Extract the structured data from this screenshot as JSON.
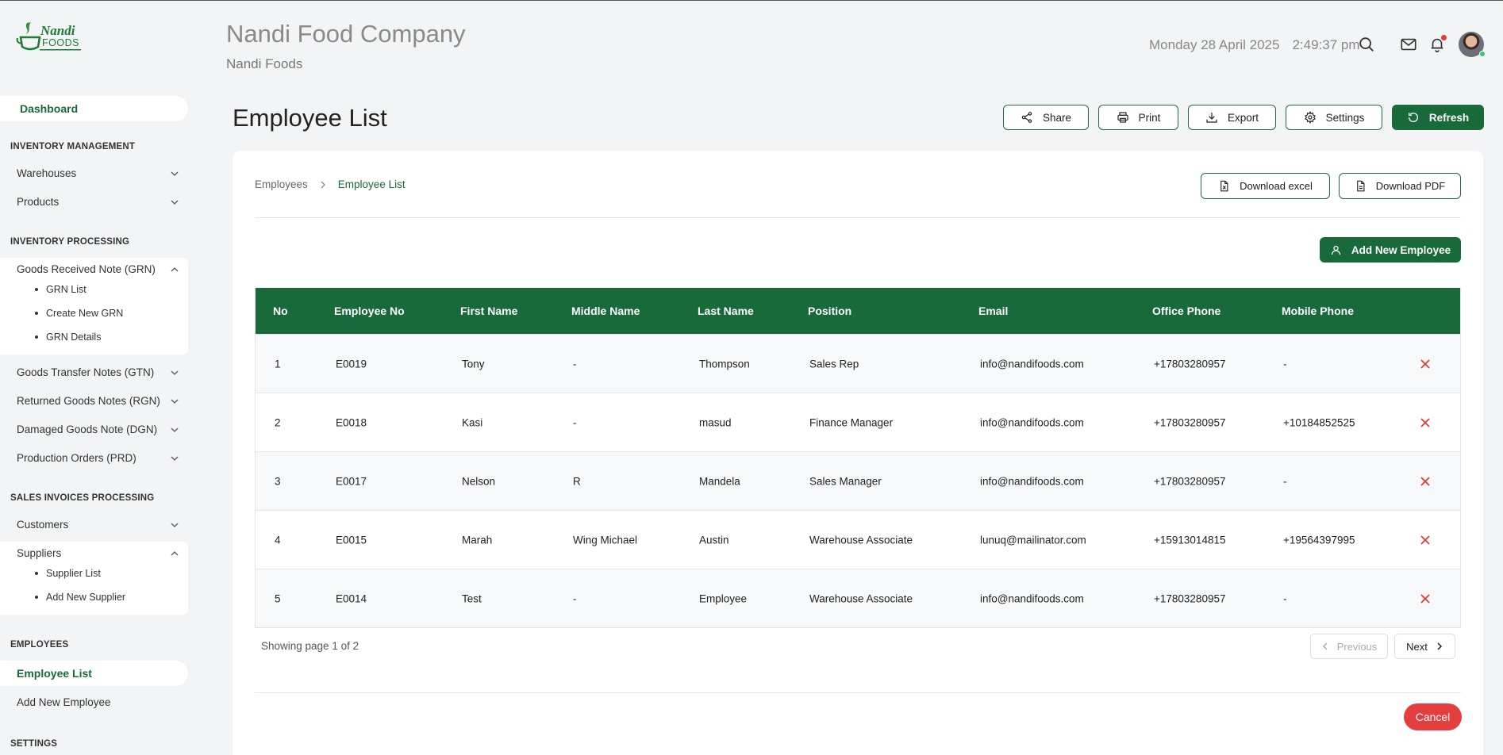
{
  "header": {
    "logo_text": "Nandi FOODS",
    "company_title": "Nandi Food Company",
    "company_subtitle": "Nandi Foods",
    "date": "Monday 28 April 2025",
    "time": "2:49:37 pm",
    "icons": [
      "search-icon",
      "mail-icon",
      "bell-icon",
      "avatar"
    ]
  },
  "sidebar": {
    "dashboard": "Dashboard",
    "sections": {
      "inventory_management": "INVENTORY MANAGEMENT",
      "inventory_processing": "INVENTORY PROCESSING",
      "sales_invoices": "SALES INVOICES PROCESSING",
      "employees": "EMPLOYEES",
      "settings": "SETTINGS"
    },
    "warehouses": "Warehouses",
    "products": "Products",
    "grn": "Goods Received Note (GRN)",
    "grn_sub": [
      "GRN List",
      "Create New GRN",
      "GRN Details"
    ],
    "gtn": "Goods Transfer Notes (GTN)",
    "rgn": "Returned Goods Notes (RGN)",
    "dgn": "Damaged Goods Note (DGN)",
    "prd": "Production Orders (PRD)",
    "customers": "Customers",
    "suppliers": "Suppliers",
    "suppliers_sub": [
      "Supplier List",
      "Add New Supplier"
    ],
    "employee_list": "Employee List",
    "add_employee": "Add New Employee"
  },
  "page": {
    "title": "Employee List",
    "toolbar": {
      "share": "Share",
      "print": "Print",
      "export": "Export",
      "settings": "Settings",
      "refresh": "Refresh"
    },
    "breadcrumb": [
      "Employees",
      "Employee List"
    ],
    "download_excel": "Download excel",
    "download_pdf": "Download PDF",
    "add_employee": "Add New Employee",
    "table": {
      "headers": [
        "No",
        "Employee No",
        "First Name",
        "Middle Name",
        "Last Name",
        "Position",
        "Email",
        "Office Phone",
        "Mobile Phone"
      ],
      "rows": [
        [
          "1",
          "E0019",
          "Tony",
          "-",
          "Thompson",
          "Sales Rep",
          "info@nandifoods.com",
          "+17803280957",
          "-"
        ],
        [
          "2",
          "E0018",
          "Kasi",
          "-",
          "masud",
          "Finance Manager",
          "info@nandifoods.com",
          "+17803280957",
          "+10184852525"
        ],
        [
          "3",
          "E0017",
          "Nelson",
          "R",
          "Mandela",
          "Sales Manager",
          "info@nandifoods.com",
          "+17803280957",
          "-"
        ],
        [
          "4",
          "E0015",
          "Marah",
          "Wing Michael",
          "Austin",
          "Warehouse Associate",
          "lunuq@mailinator.com",
          "+15913014815",
          "+19564397995"
        ],
        [
          "5",
          "E0014",
          "Test",
          "-",
          "Employee",
          "Warehouse Associate",
          "info@nandifoods.com",
          "+17803280957",
          "-"
        ]
      ]
    },
    "pagination": {
      "info": "Showing page 1 of 2",
      "previous": "Previous",
      "next": "Next"
    },
    "cancel": "Cancel"
  },
  "colors": {
    "brand_green": "#186a3b",
    "danger_red": "#e53e3e",
    "background": "#f3f4f5"
  }
}
